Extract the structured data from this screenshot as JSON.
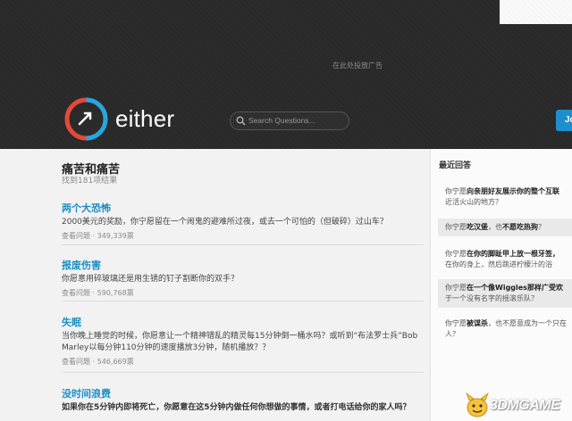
{
  "header": {
    "ad_text": "在此处投放广告",
    "brand": "either",
    "search_placeholder": "Search Questions...",
    "join_label": "Jo"
  },
  "main": {
    "title": "痛苦和痛苦",
    "result_count": "找到181项结果",
    "questions": [
      {
        "title": "两个大恐怖",
        "desc": "2000美元的奖励，你宁愿留在一个闹鬼的避难所过夜，或去一个可怕的（但破碎）过山车？",
        "meta": "查看问题 · 349,339票"
      },
      {
        "title": "报废伤害",
        "desc": "你愿意用碎玻璃还是用生锈的钉子割断你的双手？",
        "meta": "查看问题 · 590,768票"
      },
      {
        "title": "失眠",
        "desc": "当你晚上睡觉的时候，你愿意让一个精神错乱的精灵每15分钟倒一桶水吗？或听到“布法罗士兵”Bob Marley以每分钟110分钟的速度播放3分钟，随机播放？？",
        "meta": "查看问题 · 546,669票"
      },
      {
        "title": "没时间浪费",
        "desc": "如果你在5分钟内即将死亡，你愿意在这5分钟内做任何你想做的事情，或者打电话给你的家人吗？"
      }
    ]
  },
  "sidebar": {
    "title": "最近回答",
    "items": [
      {
        "prefix": "你宁愿",
        "bold": "向亲朋好友展示你的整个互联",
        "rest": "近活火山的地方？"
      },
      {
        "prefix": "你宁愿",
        "bold": "吃汉堡",
        "mid": "，也",
        "bold2": "不愿吃热狗",
        "rest": "？"
      },
      {
        "prefix": "你宁愿",
        "bold": "在你的脚趾甲上放一根牙签，",
        "rest": "在你的身上，然后跳进柠檬汁的浴"
      },
      {
        "prefix": "你宁愿",
        "bold": "在一个像Wiggles那样广受欢",
        "rest": "于一个没有名字的摇滚乐队？"
      },
      {
        "prefix": "你宁愿",
        "bold": "被谋杀",
        "mid": "，也不愿意成为一个只在",
        "rest": "人？"
      }
    ]
  },
  "watermark": {
    "text": "3DMGAME"
  },
  "colors": {
    "accent": "#1a8fc4",
    "logo_red": "#e5493a",
    "logo_blue": "#2aa6df",
    "header_bg": "#2a2a2b"
  }
}
